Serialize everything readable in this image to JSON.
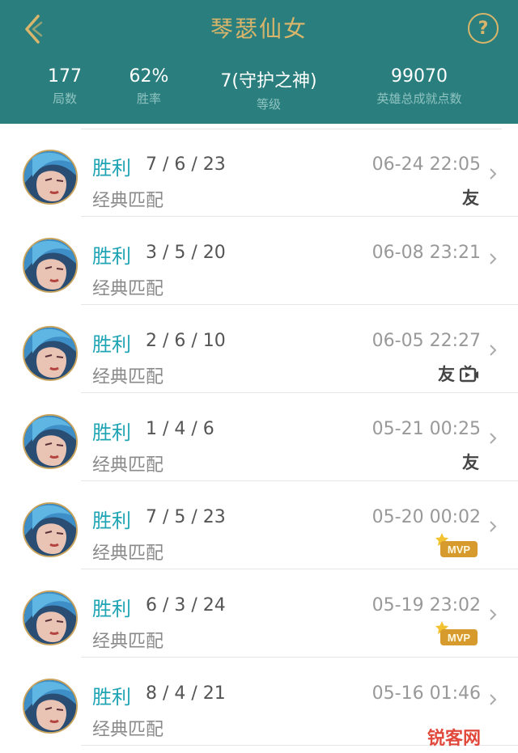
{
  "header": {
    "title": "琴瑟仙女",
    "back_icon": "back-chevron-icon",
    "help_label": "?",
    "colors": {
      "background": "#2a7f7e",
      "accent": "#d8b56a"
    }
  },
  "stats": [
    {
      "value": "177",
      "label": "局数"
    },
    {
      "value": "62%",
      "label": "胜率"
    },
    {
      "value": "7(守护之神)",
      "label": "等级"
    },
    {
      "value": "99070",
      "label": "英雄总成就点数"
    }
  ],
  "matches": [
    {
      "result": "胜利",
      "kda": "7 / 6 / 23",
      "mode": "经典匹配",
      "time": "06-24 22:05",
      "tags": [
        "友"
      ],
      "video": false,
      "mvp": false
    },
    {
      "result": "胜利",
      "kda": "3 / 5 / 20",
      "mode": "经典匹配",
      "time": "06-08 23:21",
      "tags": [],
      "video": false,
      "mvp": false
    },
    {
      "result": "胜利",
      "kda": "2 / 6 / 10",
      "mode": "经典匹配",
      "time": "06-05 22:27",
      "tags": [
        "友"
      ],
      "video": true,
      "mvp": false
    },
    {
      "result": "胜利",
      "kda": "1 / 4 / 6",
      "mode": "经典匹配",
      "time": "05-21 00:25",
      "tags": [
        "友"
      ],
      "video": false,
      "mvp": false
    },
    {
      "result": "胜利",
      "kda": "7 / 5 / 23",
      "mode": "经典匹配",
      "time": "05-20 00:02",
      "tags": [],
      "video": false,
      "mvp": true
    },
    {
      "result": "胜利",
      "kda": "6 / 3 / 24",
      "mode": "经典匹配",
      "time": "05-19 23:02",
      "tags": [],
      "video": false,
      "mvp": true
    },
    {
      "result": "胜利",
      "kda": "8 / 4 / 21",
      "mode": "经典匹配",
      "time": "05-16 01:46",
      "tags": [],
      "video": false,
      "mvp": false
    }
  ],
  "mvp_label": "MVP",
  "watermark": {
    "text": "锐客网"
  }
}
